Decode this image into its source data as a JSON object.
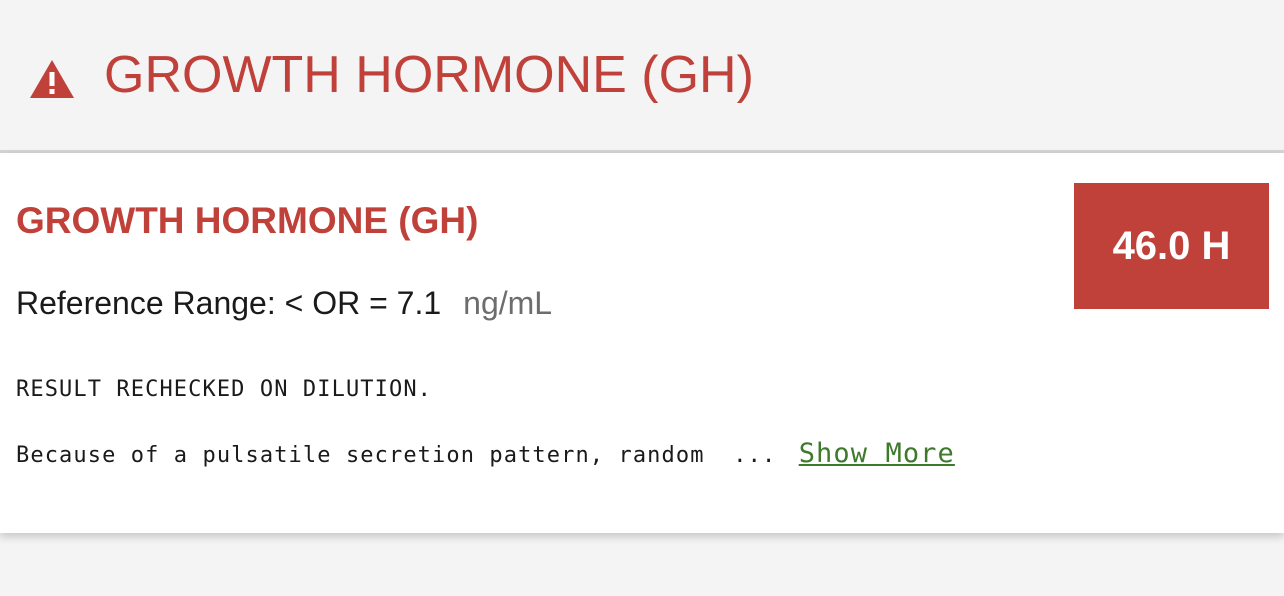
{
  "header": {
    "icon": "warning-triangle-icon",
    "title": "GROWTH HORMONE (GH)",
    "accent_color": "#c0403a"
  },
  "result": {
    "test_name": "GROWTH HORMONE (GH)",
    "reference_label": "Reference Range: < OR = 7.1",
    "unit": "ng/mL",
    "value": "46.0 H",
    "flag_color": "#c0403a",
    "comment_lines": [
      "RESULT RECHECKED ON DILUTION.",
      "Because of a pulsatile secretion pattern, random"
    ],
    "ellipsis": "...",
    "show_more_label": "Show More",
    "link_color": "#3d7a2b"
  }
}
